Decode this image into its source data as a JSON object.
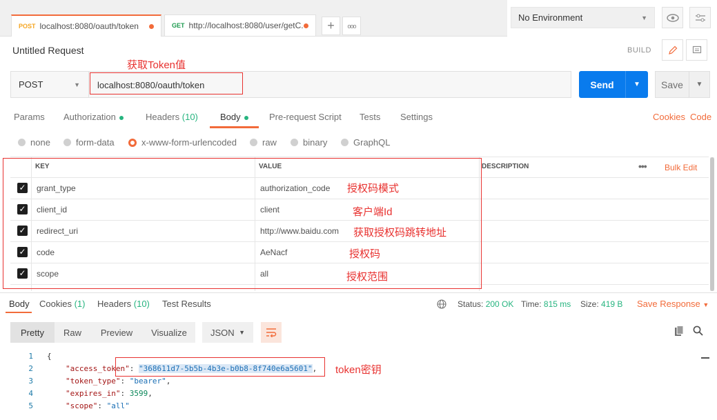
{
  "tabs": [
    {
      "method": "POST",
      "title": "localhost:8080/oauth/token"
    },
    {
      "method": "GET",
      "title": "http://localhost:8080/user/getC..."
    }
  ],
  "tab_actions": {
    "add": "+",
    "more": "ooo"
  },
  "environment": {
    "selected": "No Environment"
  },
  "request": {
    "title": "Untitled Request",
    "build_label": "BUILD",
    "method": "POST",
    "url": "localhost:8080/oauth/token",
    "send_label": "Send",
    "save_label": "Save"
  },
  "request_tabs": {
    "params": "Params",
    "authorization": "Authorization",
    "headers": "Headers",
    "headers_count": "(10)",
    "body": "Body",
    "prerequest": "Pre-request Script",
    "tests": "Tests",
    "settings": "Settings",
    "cookies": "Cookies",
    "code": "Code"
  },
  "body_types": [
    "none",
    "form-data",
    "x-www-form-urlencoded",
    "raw",
    "binary",
    "GraphQL"
  ],
  "body_selected": "x-www-form-urlencoded",
  "table": {
    "headers": {
      "key": "KEY",
      "value": "VALUE",
      "description": "DESCRIPTION",
      "bulk_edit": "Bulk Edit"
    },
    "rows": [
      {
        "key": "grant_type",
        "value": "authorization_code",
        "checked": true
      },
      {
        "key": "client_id",
        "value": "client",
        "checked": true
      },
      {
        "key": "redirect_uri",
        "value": "http://www.baidu.com",
        "checked": true
      },
      {
        "key": "code",
        "value": "AeNacf",
        "checked": true
      },
      {
        "key": "scope",
        "value": "all",
        "checked": true
      }
    ]
  },
  "annotations": {
    "url": "获取Token值",
    "grant_type": "授权码模式",
    "client_id": "客户端Id",
    "redirect_uri": "获取授权码跳转地址",
    "code": "授权码",
    "scope": "授权范围",
    "token": "token密钥"
  },
  "response": {
    "tabs": {
      "body": "Body",
      "cookies": "Cookies",
      "cookies_count": "(1)",
      "headers": "Headers",
      "headers_count": "(10)",
      "tests": "Test Results"
    },
    "status_label": "Status:",
    "status_value": "200 OK",
    "time_label": "Time:",
    "time_value": "815 ms",
    "size_label": "Size:",
    "size_value": "419 B",
    "save_response": "Save Response",
    "view_modes": [
      "Pretty",
      "Raw",
      "Preview",
      "Visualize"
    ],
    "format": "JSON",
    "lines": [
      {
        "n": "1",
        "text": "{"
      },
      {
        "n": "2",
        "key": "\"access_token\"",
        "value": "\"368611d7-5b5b-4b3e-b0b8-8f740e6a5601\"",
        "suffix": ","
      },
      {
        "n": "3",
        "key": "\"token_type\"",
        "value": "\"bearer\"",
        "suffix": ","
      },
      {
        "n": "4",
        "key": "\"expires_in\"",
        "value": "3599",
        "suffix": ","
      },
      {
        "n": "5",
        "key": "\"scope\"",
        "value": "\"all\"",
        "suffix": ""
      }
    ]
  },
  "colors": {
    "accent": "#f26b3a",
    "send": "#097bed",
    "annotation": "#e8312f",
    "ok": "#26b47f"
  }
}
